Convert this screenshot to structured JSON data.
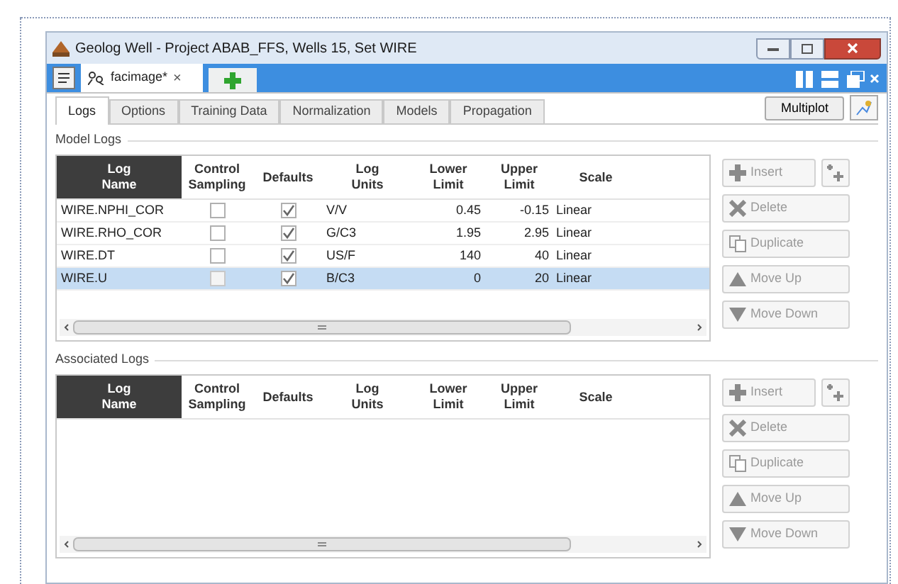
{
  "window": {
    "title": "Geolog Well - Project ABAB_FFS, Wells 15, Set WIRE"
  },
  "doc_tab": {
    "label": "facimage*",
    "close": "×"
  },
  "tabs": [
    {
      "label": "Logs",
      "selected": true
    },
    {
      "label": "Options",
      "selected": false
    },
    {
      "label": "Training Data",
      "selected": false
    },
    {
      "label": "Normalization",
      "selected": false
    },
    {
      "label": "Models",
      "selected": false
    },
    {
      "label": "Propagation",
      "selected": false
    }
  ],
  "multiplot": "Multiplot",
  "sections": [
    {
      "title": "Model Logs",
      "columns": [
        {
          "label": "Log Name",
          "selected": true
        },
        {
          "label": "Control Sampling",
          "selected": false
        },
        {
          "label": "Defaults",
          "selected": false
        },
        {
          "label": "Log Units",
          "selected": false
        },
        {
          "label": "Lower Limit",
          "selected": false
        },
        {
          "label": "Upper Limit",
          "selected": false
        },
        {
          "label": "Scale",
          "selected": false
        }
      ],
      "rows": [
        {
          "name": "WIRE.NPHI_COR",
          "control_sampling": false,
          "defaults": true,
          "units": "V/V",
          "lower": "0.45",
          "upper": "-0.15",
          "scale": "Linear",
          "selected": false
        },
        {
          "name": "WIRE.RHO_COR",
          "control_sampling": false,
          "defaults": true,
          "units": "G/C3",
          "lower": "1.95",
          "upper": "2.95",
          "scale": "Linear",
          "selected": false
        },
        {
          "name": "WIRE.DT",
          "control_sampling": false,
          "defaults": true,
          "units": "US/F",
          "lower": "140",
          "upper": "40",
          "scale": "Linear",
          "selected": false
        },
        {
          "name": "WIRE.U",
          "control_sampling": false,
          "defaults": true,
          "units": "B/C3",
          "lower": "0",
          "upper": "20",
          "scale": "Linear",
          "selected": true
        }
      ],
      "buttons": [
        {
          "kind": "insert",
          "label": "Insert",
          "disabled": true
        },
        {
          "kind": "delete",
          "label": "Delete",
          "disabled": true
        },
        {
          "kind": "duplicate",
          "label": "Duplicate",
          "disabled": true
        },
        {
          "kind": "up",
          "label": "Move Up",
          "disabled": true
        },
        {
          "kind": "down",
          "label": "Move Down",
          "disabled": true
        }
      ]
    },
    {
      "title": "Associated Logs",
      "columns": [
        {
          "label": "Log Name",
          "selected": true
        },
        {
          "label": "Control Sampling",
          "selected": false
        },
        {
          "label": "Defaults",
          "selected": false
        },
        {
          "label": "Log Units",
          "selected": false
        },
        {
          "label": "Lower Limit",
          "selected": false
        },
        {
          "label": "Upper Limit",
          "selected": false
        },
        {
          "label": "Scale",
          "selected": false
        }
      ],
      "buttons": [
        {
          "kind": "insert",
          "label": "Insert",
          "disabled": true
        },
        {
          "kind": "delete",
          "label": "Delete",
          "disabled": true
        },
        {
          "kind": "duplicate",
          "label": "Duplicate",
          "disabled": true
        },
        {
          "kind": "up",
          "label": "Move Up",
          "disabled": true
        },
        {
          "kind": "down",
          "label": "Move Down",
          "disabled": true
        }
      ]
    }
  ]
}
